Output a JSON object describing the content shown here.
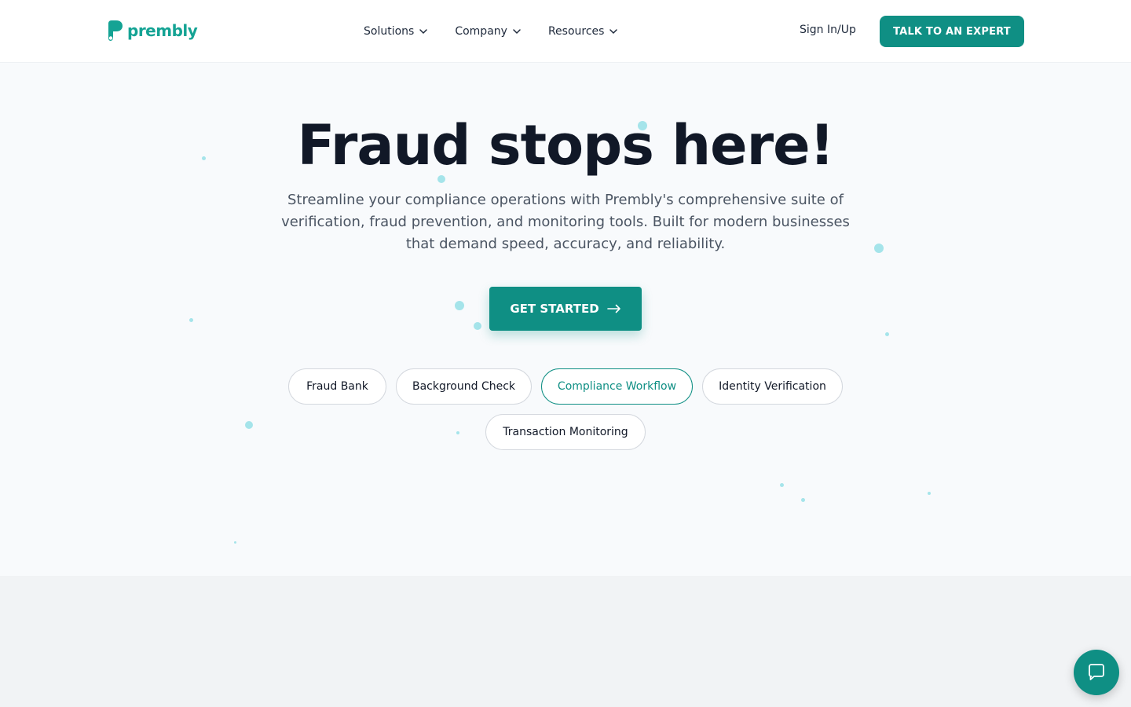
{
  "brand": {
    "name": "prembly",
    "color": "#14a394"
  },
  "nav": {
    "menu": [
      {
        "label": "Solutions",
        "icon": "chevron-down-icon"
      },
      {
        "label": "Company",
        "icon": "chevron-down-icon"
      },
      {
        "label": "Resources",
        "icon": "chevron-down-icon"
      }
    ],
    "sign_in": "Sign In/Up",
    "cta": "TALK TO AN EXPERT"
  },
  "hero": {
    "headline": "Fraud stops here!",
    "subheadline": "Streamline your compliance operations with Prembly's comprehensive suite of verification, fraud prevention, and monitoring tools. Built for modern businesses that demand speed, accuracy, and reliability.",
    "cta": "GET STARTED",
    "cta_icon": "arrow-right-icon",
    "chips": [
      {
        "label": "Fraud Bank",
        "active": false
      },
      {
        "label": "Background Check",
        "active": false
      },
      {
        "label": "Compliance Workflow",
        "active": true
      },
      {
        "label": "Identity Verification",
        "active": false
      },
      {
        "label": "Transaction Monitoring",
        "active": false
      }
    ]
  },
  "chat": {
    "icon": "chat-icon"
  },
  "colors": {
    "accent": "#0f8f84",
    "dots": "#a5e4ea",
    "heading": "#111827",
    "body_text": "#4b5563"
  }
}
